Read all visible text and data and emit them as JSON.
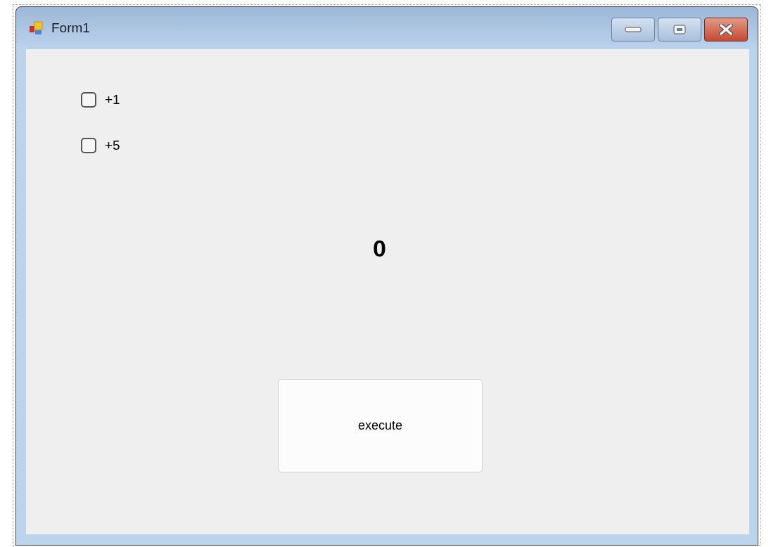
{
  "window": {
    "title": "Form1"
  },
  "checkboxes": [
    {
      "label": "+1",
      "checked": false
    },
    {
      "label": "+5",
      "checked": false
    }
  ],
  "result_label": "0",
  "buttons": [
    {
      "label": "execute"
    }
  ]
}
